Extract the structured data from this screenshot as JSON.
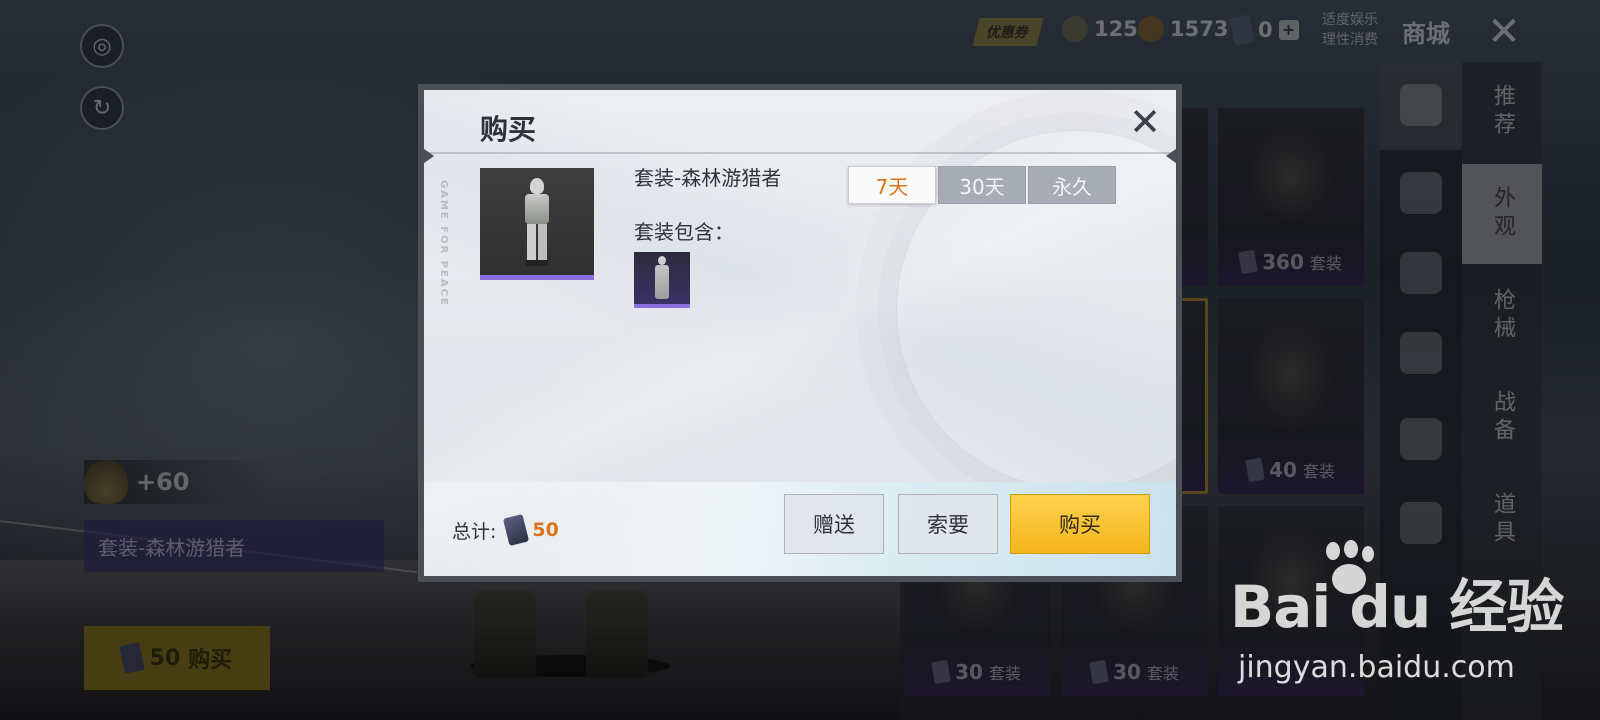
{
  "topbar": {
    "coupon_label": "优惠券",
    "currencies": [
      {
        "icon": "gold-coin-icon",
        "value": "125"
      },
      {
        "icon": "bronze-coin-icon",
        "value": "1573"
      },
      {
        "icon": "card-currency-icon",
        "value": "0"
      }
    ],
    "add_label": "+",
    "notice_line1": "适度娱乐",
    "notice_line2": "理性消费",
    "title": "商城",
    "close_label": "✕"
  },
  "category_nav": [
    {
      "label": "推荐",
      "active": false
    },
    {
      "label": "外观",
      "active": true
    },
    {
      "label": "枪械",
      "active": false
    },
    {
      "label": "战备",
      "active": false
    },
    {
      "label": "道具",
      "active": false
    }
  ],
  "grid": [
    {
      "price": "360",
      "unit": "套装"
    },
    {
      "price": "40",
      "unit": "套装"
    },
    {
      "price": "30",
      "unit": "套装"
    },
    {
      "price": "30",
      "unit": "套装"
    }
  ],
  "left_panel": {
    "xp": "+60",
    "item_name": "套装-森林游猎者",
    "buy_price": "50",
    "buy_label": "购买"
  },
  "modal": {
    "title": "购买",
    "close": "✕",
    "side_text": "GAME FOR PEACE",
    "item_name": "套装-森林游猎者",
    "durations": [
      {
        "label": "7天",
        "active": true
      },
      {
        "label": "30天",
        "active": false
      },
      {
        "label": "永久",
        "active": false
      }
    ],
    "includes_label": "套装包含：",
    "total_label": "总计:",
    "total_amount": "50",
    "gift_label": "赠送",
    "request_label": "索要",
    "buy_label": "购买",
    "colors": {
      "accent": "#e0731a",
      "buy_button": "#f4b51c",
      "rarity": "#8a6fe0"
    }
  },
  "watermark": {
    "logo": "Bai  du 经验",
    "url": "jingyan.baidu.com"
  }
}
